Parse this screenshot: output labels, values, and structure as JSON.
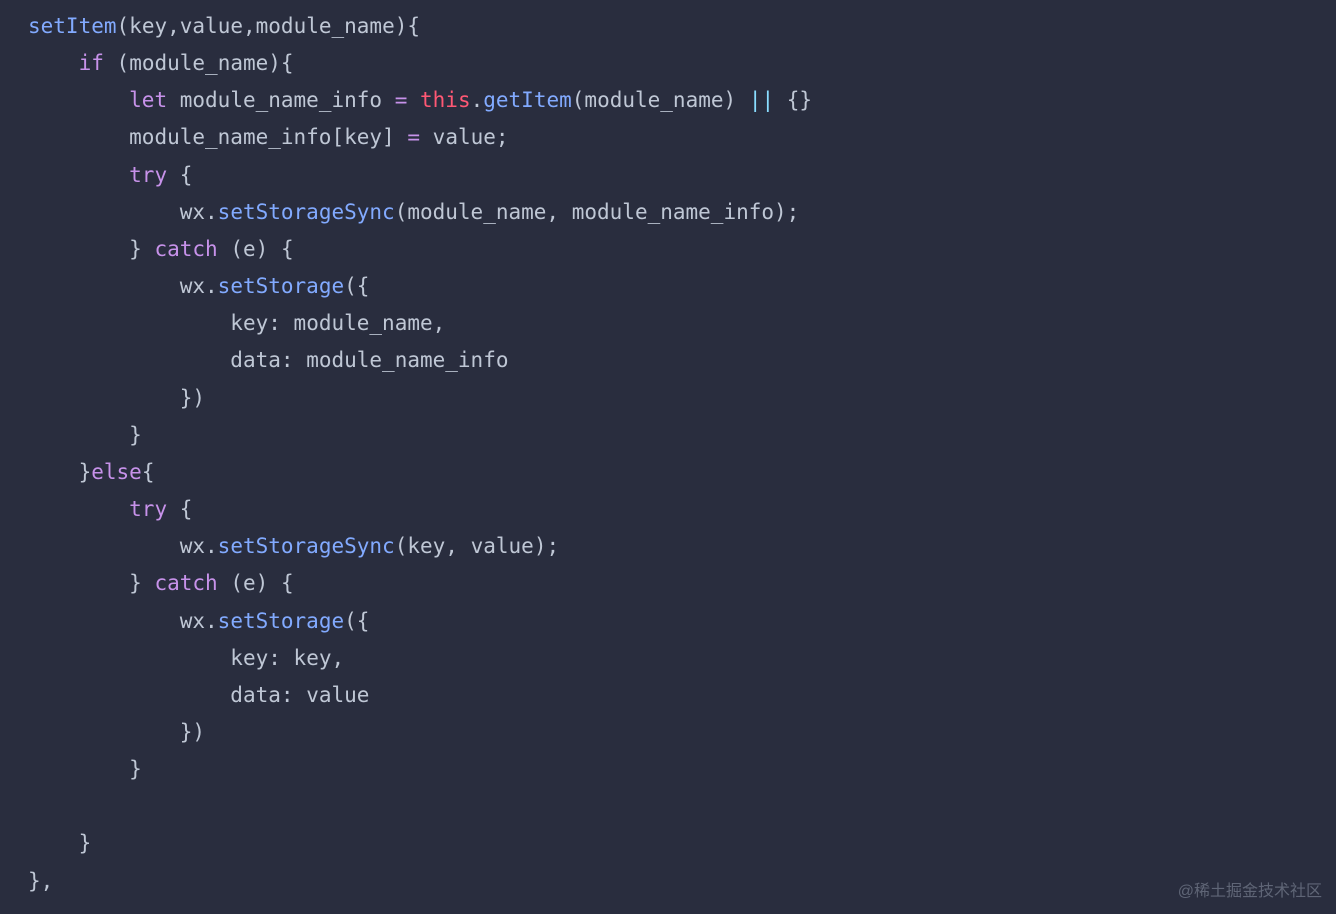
{
  "code": {
    "fn_name": "setItem",
    "params": [
      "key",
      "value",
      "module_name"
    ],
    "if_kw": "if",
    "let_kw": "let",
    "var_name": "module_name_info",
    "this_kw": "this",
    "getItem": "getItem",
    "try_kw": "try",
    "catch_kw": "catch",
    "catch_param": "e",
    "else_kw": "else",
    "wx": "wx",
    "setStorageSync": "setStorageSync",
    "setStorage": "setStorage",
    "key_prop": "key",
    "data_prop": "data",
    "value_id": "value",
    "module_name_id": "module_name",
    "module_name_info_id": "module_name_info",
    "key_id": "key"
  },
  "watermark": "@稀土掘金技术社区"
}
